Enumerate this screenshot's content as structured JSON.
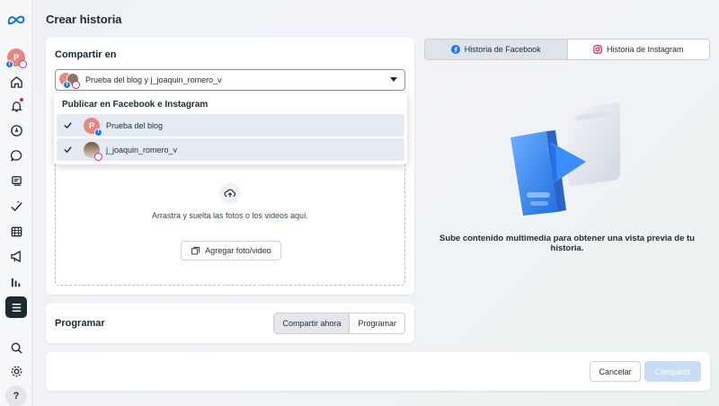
{
  "page": {
    "title": "Crear historia"
  },
  "share": {
    "heading": "Compartir en",
    "selected_text": "Prueba del blog y j_joaquin_romero_v",
    "dropzone": {
      "text": "Arrastra y suelta las fotos o los videos aquí.",
      "add_button": "Agregar foto/video"
    }
  },
  "dropdown": {
    "heading": "Publicar en Facebook e Instagram",
    "items": [
      {
        "label": "Prueba del blog",
        "avatar_letter": "P",
        "checked": true,
        "platform": "facebook"
      },
      {
        "label": "j_joaquin_romero_v",
        "checked": true,
        "platform": "instagram"
      }
    ]
  },
  "schedule": {
    "label": "Programar",
    "options": [
      "Compartir ahora",
      "Programar"
    ],
    "selected": "Compartir ahora"
  },
  "footer": {
    "cancel": "Cancelar",
    "share": "Compartir"
  },
  "preview": {
    "tabs": [
      {
        "label": "Historia de Facebook",
        "icon": "facebook-icon",
        "active": true
      },
      {
        "label": "Historia de Instagram",
        "icon": "instagram-icon",
        "active": false
      }
    ],
    "caption": "Sube contenido multimedia para obtener una vista previa de tu historia."
  },
  "sidebar": {
    "avatar_letter": "P",
    "icons": [
      "meta-logo-icon",
      "home-icon",
      "bell-icon",
      "compass-icon",
      "chat-icon",
      "stack-icon",
      "ads-icon",
      "calendar-icon",
      "megaphone-icon",
      "chart-icon",
      "menu-icon",
      "search-icon",
      "gear-icon",
      "help-icon"
    ],
    "help_label": "?"
  },
  "colors": {
    "facebook": "#1877f2",
    "instagram": "#d62976",
    "disabled_share": "#c7dcf5"
  }
}
